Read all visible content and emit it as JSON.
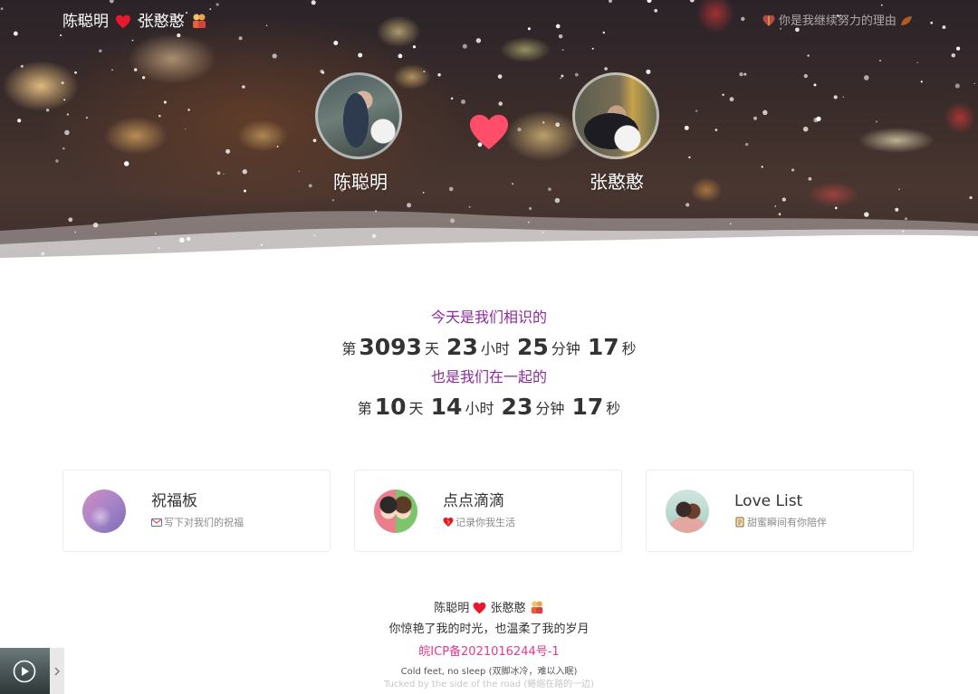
{
  "header": {
    "name_left": "陈聪明",
    "name_right": "张憨憨",
    "tagline": "你是我继续努力的理由"
  },
  "hero": {
    "left_name": "陈聪明",
    "right_name": "张憨憨"
  },
  "counter": {
    "title_1": "今天是我们相识的",
    "prefix_1": "第",
    "days_1": "3093",
    "days_unit_1": "天",
    "hours_1": "23",
    "hours_unit_1": "小时",
    "minutes_1": "25",
    "minutes_unit_1": "分钟",
    "seconds_1": "17",
    "seconds_unit_1": "秒",
    "title_2": "也是我们在一起的",
    "prefix_2": "第",
    "days_2": "10",
    "days_unit_2": "天",
    "hours_2": "14",
    "hours_unit_2": "小时",
    "minutes_2": "23",
    "minutes_unit_2": "分钟",
    "seconds_2": "17",
    "seconds_unit_2": "秒"
  },
  "cards": [
    {
      "title": "祝福板",
      "subtitle": "写下对我们的祝福",
      "icon": "envelope-icon"
    },
    {
      "title": "点点滴滴",
      "subtitle": "记录你我生活",
      "icon": "heart-icon"
    },
    {
      "title": "Love List",
      "subtitle": "甜蜜瞬间有你陪伴",
      "icon": "scroll-icon"
    }
  ],
  "footer": {
    "name_left": "陈聪明",
    "name_right": "张憨憨",
    "motto": "你惊艳了我的时光，也温柔了我的岁月",
    "icp": "皖ICP备2021016244号-1",
    "song_line_1": "Cold feet, no sleep (双脚冰冷，难以入眠)",
    "song_line_2": "Tucked by the side of the road (蜷缩在路的一边)"
  },
  "colors": {
    "accent_purple": "#8c2a9c",
    "icp_pink": "#e13a8f",
    "heart_red": "#ff4d6a"
  }
}
